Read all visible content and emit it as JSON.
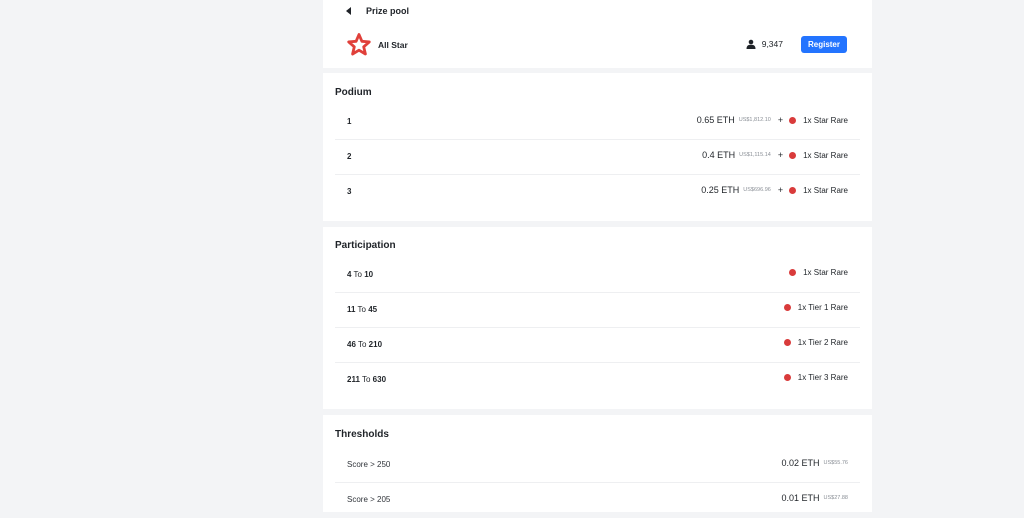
{
  "header": {
    "title": "Prize pool",
    "league_name": "All Star",
    "player_count": "9,347",
    "register_label": "Register",
    "accent_color": "#2374ff",
    "logo_icon": "red-star-icon",
    "back_icon": "chevron-left-icon",
    "user_icon": "person-icon"
  },
  "podium": {
    "title": "Podium",
    "rows": [
      {
        "rank": "1",
        "eth": "0.65 ETH",
        "usd": "US$1,812.10",
        "plus": "+",
        "reward": "1x Star Rare"
      },
      {
        "rank": "2",
        "eth": "0.4 ETH",
        "usd": "US$1,115.14",
        "plus": "+",
        "reward": "1x Star Rare"
      },
      {
        "rank": "3",
        "eth": "0.25 ETH",
        "usd": "US$696.96",
        "plus": "+",
        "reward": "1x Star Rare"
      }
    ]
  },
  "participation": {
    "title": "Participation",
    "to_word": "To",
    "rows": [
      {
        "from": "4",
        "to": "10",
        "reward": "1x Star Rare"
      },
      {
        "from": "11",
        "to": "45",
        "reward": "1x Tier 1 Rare"
      },
      {
        "from": "46",
        "to": "210",
        "reward": "1x Tier 2 Rare"
      },
      {
        "from": "211",
        "to": "630",
        "reward": "1x Tier 3 Rare"
      }
    ]
  },
  "thresholds": {
    "title": "Thresholds",
    "rows": [
      {
        "score": "Score > 250",
        "eth": "0.02 ETH",
        "usd": "US$55.76"
      },
      {
        "score": "Score > 205",
        "eth": "0.01 ETH",
        "usd": "US$27.88"
      }
    ]
  },
  "colors": {
    "rare_dot": "#d93b3b",
    "logo": "#e0403a"
  }
}
